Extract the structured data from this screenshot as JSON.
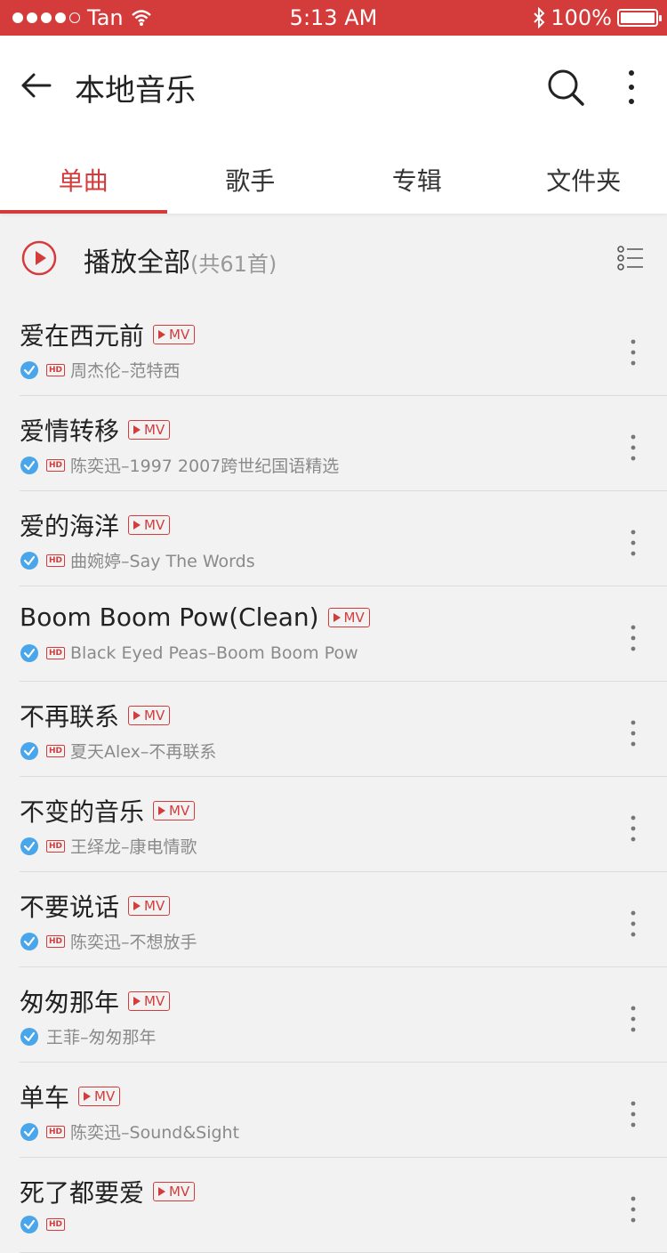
{
  "status": {
    "carrier": "Tan",
    "time": "5:13 AM",
    "battery": "100%"
  },
  "header": {
    "title": "本地音乐"
  },
  "tabs": [
    {
      "label": "单曲",
      "active": true
    },
    {
      "label": "歌手",
      "active": false
    },
    {
      "label": "专辑",
      "active": false
    },
    {
      "label": "文件夹",
      "active": false
    }
  ],
  "playall": {
    "label": "播放全部",
    "count": "(共61首)"
  },
  "accent": "#d43c3c",
  "songs": [
    {
      "title": "爱在西元前",
      "mv": "MV",
      "hd": "HD",
      "sub": "周杰伦–范特西"
    },
    {
      "title": "爱情转移",
      "mv": "MV",
      "hd": "HD",
      "sub": "陈奕迅–1997 2007跨世纪国语精选"
    },
    {
      "title": "爱的海洋",
      "mv": "MV",
      "hd": "HD",
      "sub": "曲婉婷–Say The Words"
    },
    {
      "title": "Boom Boom Pow(Clean)",
      "mv": "MV",
      "hd": "HD",
      "sub": "Black Eyed Peas–Boom Boom Pow"
    },
    {
      "title": "不再联系",
      "mv": "MV",
      "hd": "HD",
      "sub": "夏天Alex–不再联系"
    },
    {
      "title": "不变的音乐",
      "mv": "MV",
      "hd": "HD",
      "sub": "王绎龙–康电情歌"
    },
    {
      "title": "不要说话",
      "mv": "MV",
      "hd": "HD",
      "sub": "陈奕迅–不想放手"
    },
    {
      "title": "匆匆那年",
      "mv": "MV",
      "hd": "",
      "sub": "王菲–匆匆那年"
    },
    {
      "title": "单车",
      "mv": "MV",
      "hd": "HD",
      "sub": "陈奕迅–Sound&Sight"
    },
    {
      "title": "死了都要爱",
      "mv": "MV",
      "hd": "HD",
      "sub": ""
    }
  ]
}
